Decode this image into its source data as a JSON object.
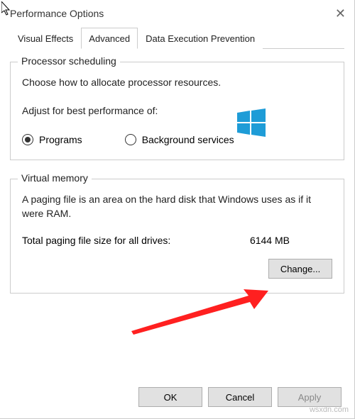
{
  "window": {
    "title": "Performance Options"
  },
  "tabs": {
    "visual": "Visual Effects",
    "advanced": "Advanced",
    "dep": "Data Execution Prevention"
  },
  "processor": {
    "title": "Processor scheduling",
    "desc": "Choose how to allocate processor resources.",
    "adjust": "Adjust for best performance of:",
    "opt_programs": "Programs",
    "opt_bg": "Background services"
  },
  "vm": {
    "title": "Virtual memory",
    "desc": "A paging file is an area on the hard disk that Windows uses as if it were RAM.",
    "total_label": "Total paging file size for all drives:",
    "total_value": "6144 MB",
    "change_btn": "Change..."
  },
  "buttons": {
    "ok": "OK",
    "cancel": "Cancel",
    "apply": "Apply"
  },
  "watermark": "wsxdn.com"
}
